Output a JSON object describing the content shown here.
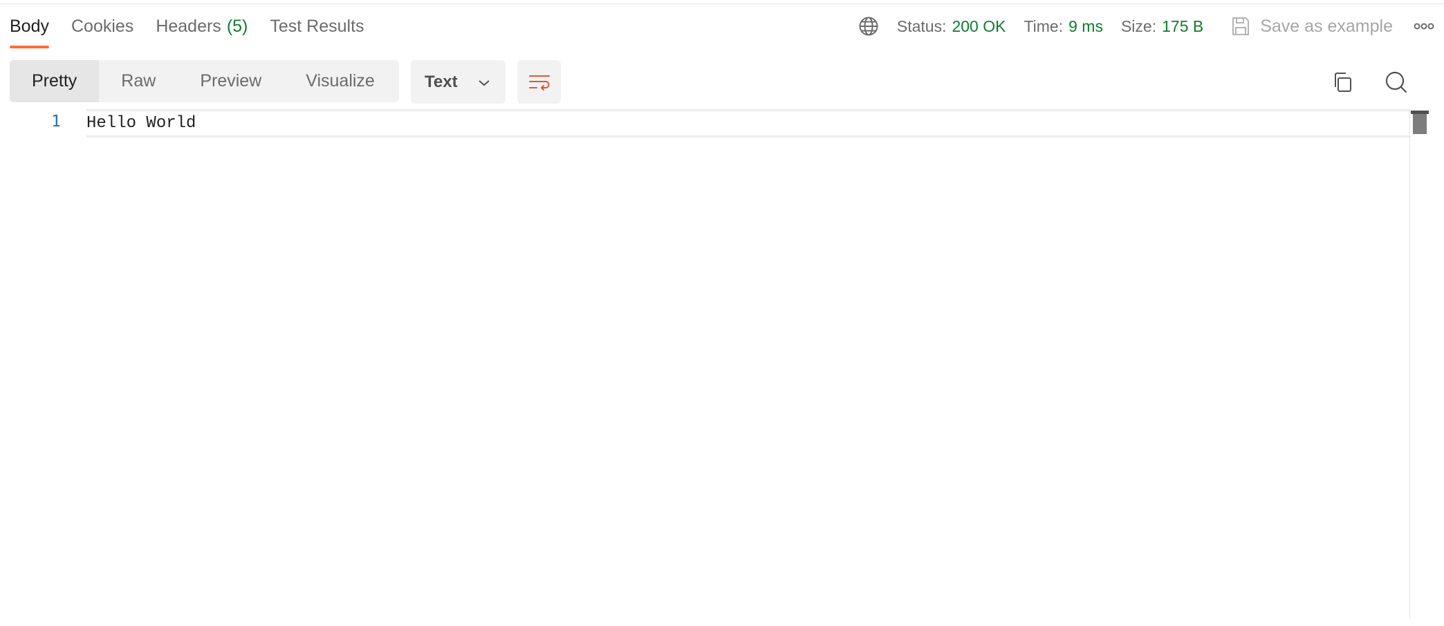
{
  "tabs": [
    {
      "label": "Body",
      "count": ""
    },
    {
      "label": "Cookies",
      "count": ""
    },
    {
      "label": "Headers",
      "count": "(5)"
    },
    {
      "label": "Test Results",
      "count": ""
    }
  ],
  "status": {
    "status_label": "Status:",
    "status_value": "200 OK",
    "time_label": "Time:",
    "time_value": "9 ms",
    "size_label": "Size:",
    "size_value": "175 B",
    "save_label": "Save as example"
  },
  "view_modes": [
    "Pretty",
    "Raw",
    "Preview",
    "Visualize"
  ],
  "format": {
    "selected": "Text"
  },
  "editor": {
    "lines": [
      {
        "number": "1",
        "text": "Hello World"
      }
    ]
  },
  "colors": {
    "accent": "#ff6c37",
    "success": "#0f7b2f",
    "line_number": "#1f6fb2"
  },
  "icons": {
    "globe": "globe-icon",
    "save": "save-icon",
    "more": "more-icon",
    "chevron": "chevron-down-icon",
    "wrap": "wrap-lines-icon",
    "copy": "copy-icon",
    "search": "search-icon"
  }
}
